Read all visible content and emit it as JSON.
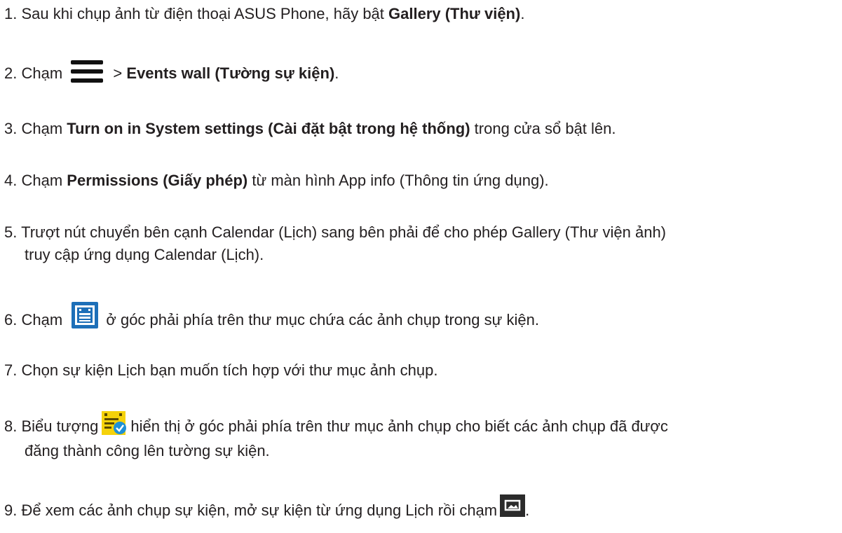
{
  "steps": [
    {
      "num": "1.",
      "pre": "Sau khi chụp ảnh từ điện thoại ASUS Phone, hãy bật ",
      "bold": "Gallery (Thư viện)",
      "post": "."
    },
    {
      "num": "2.",
      "pre": "Chạm",
      "mid": "> ",
      "bold": "Events wall (Tường sự kiện)",
      "post": "."
    },
    {
      "num": "3.",
      "pre": "Chạm ",
      "bold": "Turn on in System settings (Cài đặt bật trong hệ thống)",
      "post": " trong cửa sổ bật lên."
    },
    {
      "num": "4.",
      "pre": "Chạm ",
      "bold": "Permissions (Giấy phép)",
      "post": " từ màn hình App info (Thông tin ứng dụng)."
    },
    {
      "num": "5.",
      "line1": "Trượt nút chuyển bên cạnh Calendar (Lịch) sang bên phải để cho phép Gallery (Thư viện ảnh)",
      "line2": "truy cập ứng dụng Calendar (Lịch)."
    },
    {
      "num": "6.",
      "pre": "Chạm",
      "post": "ở góc phải phía trên thư mục chứa các ảnh chụp trong sự kiện."
    },
    {
      "num": "7.",
      "text": "Chọn sự kiện Lịch bạn muốn tích hợp với thư mục ảnh chụp."
    },
    {
      "num": "8.",
      "pre": "Biểu tượng",
      "post": "hiển thị ở góc phải phía trên thư mục ảnh chụp cho biết các ảnh chụp đã được",
      "line2": "đăng thành công lên tường sự kiện."
    },
    {
      "num": "9.",
      "pre": "Để xem các ảnh chụp sự kiện, mở sự kiện từ ứng dụng Lịch rồi chạm",
      "post": "."
    }
  ],
  "icons": {
    "menu": "menu-icon",
    "events": "events-list-icon",
    "registered": "event-registered-icon",
    "photo": "photo-icon"
  },
  "colors": {
    "text": "#231f20",
    "events_icon_blue": "#1d6fb8",
    "registered_icon_yellow": "#f5d20a",
    "registered_check_blue": "#1e90d6"
  }
}
